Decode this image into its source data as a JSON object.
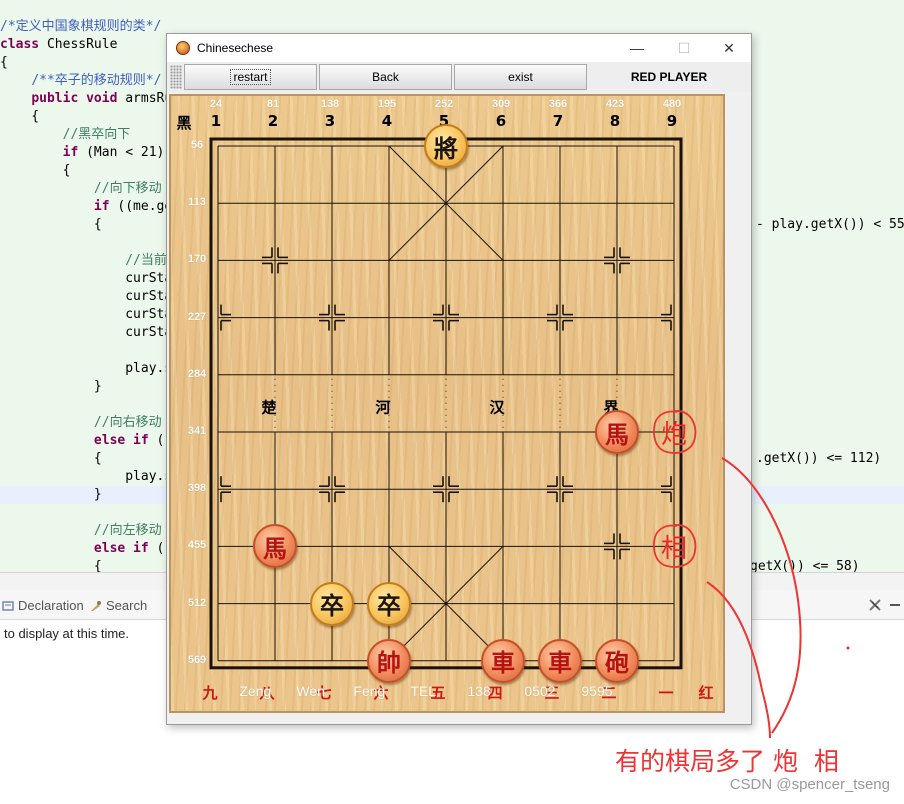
{
  "ide": {
    "code_lines": [
      {
        "parts": [
          {
            "cls": "jd",
            "t": "/*定义中国象棋规则的类*/"
          }
        ]
      },
      {
        "parts": [
          {
            "cls": "kw",
            "t": "class "
          },
          {
            "cls": "rm",
            "t": "ChessRule"
          }
        ]
      },
      {
        "parts": [
          {
            "cls": "rm",
            "t": "{"
          }
        ]
      },
      {
        "parts": [
          {
            "cls": "rm",
            "t": "    "
          },
          {
            "cls": "jd",
            "t": "/**卒子的移动规则*/"
          }
        ]
      },
      {
        "parts": [
          {
            "cls": "rm",
            "t": "    "
          },
          {
            "cls": "kw",
            "t": "public void "
          },
          {
            "cls": "rm",
            "t": "armsRu"
          }
        ]
      },
      {
        "parts": [
          {
            "cls": "rm",
            "t": "    {"
          }
        ]
      },
      {
        "parts": [
          {
            "cls": "rm",
            "t": "        "
          },
          {
            "cls": "cm",
            "t": "//黑卒向下"
          }
        ]
      },
      {
        "parts": [
          {
            "cls": "rm",
            "t": "        "
          },
          {
            "cls": "kw",
            "t": "if "
          },
          {
            "cls": "rm",
            "t": "(Man < 21)"
          }
        ]
      },
      {
        "parts": [
          {
            "cls": "rm",
            "t": "        {"
          }
        ]
      },
      {
        "parts": [
          {
            "cls": "rm",
            "t": "            "
          },
          {
            "cls": "cm",
            "t": "//向下移动"
          }
        ]
      },
      {
        "parts": [
          {
            "cls": "rm",
            "t": "            "
          },
          {
            "cls": "kw",
            "t": "if "
          },
          {
            "cls": "rm",
            "t": "((me.ge"
          }
        ]
      },
      {
        "parts": [
          {
            "cls": "rm",
            "t": "            {"
          }
        ]
      },
      {
        "parts": [
          {
            "cls": "rm",
            "t": ""
          }
        ]
      },
      {
        "parts": [
          {
            "cls": "rm",
            "t": "                "
          },
          {
            "cls": "cm",
            "t": "//当前"
          }
        ]
      },
      {
        "parts": [
          {
            "cls": "rm",
            "t": "                curSta"
          }
        ]
      },
      {
        "parts": [
          {
            "cls": "rm",
            "t": "                curSta"
          }
        ]
      },
      {
        "parts": [
          {
            "cls": "rm",
            "t": "                curSta"
          }
        ]
      },
      {
        "parts": [
          {
            "cls": "rm",
            "t": "                curSta"
          }
        ]
      },
      {
        "parts": [
          {
            "cls": "rm",
            "t": ""
          }
        ]
      },
      {
        "parts": [
          {
            "cls": "rm",
            "t": "                play.s"
          }
        ]
      },
      {
        "parts": [
          {
            "cls": "rm",
            "t": "            }"
          }
        ]
      },
      {
        "parts": [
          {
            "cls": "rm",
            "t": ""
          }
        ]
      },
      {
        "parts": [
          {
            "cls": "rm",
            "t": "            "
          },
          {
            "cls": "cm",
            "t": "//向右移动"
          }
        ]
      },
      {
        "parts": [
          {
            "cls": "rm",
            "t": "            "
          },
          {
            "cls": "kw",
            "t": "else if "
          },
          {
            "cls": "rm",
            "t": "("
          }
        ]
      },
      {
        "parts": [
          {
            "cls": "rm",
            "t": "            {"
          }
        ]
      },
      {
        "parts": [
          {
            "cls": "rm",
            "t": "                play.s"
          }
        ]
      },
      {
        "parts": [
          {
            "cls": "rm",
            "t": "            }"
          }
        ]
      },
      {
        "parts": [
          {
            "cls": "rm",
            "t": ""
          }
        ]
      },
      {
        "parts": [
          {
            "cls": "rm",
            "t": "            "
          },
          {
            "cls": "cm",
            "t": "//向左移动"
          }
        ]
      },
      {
        "parts": [
          {
            "cls": "rm",
            "t": "            "
          },
          {
            "cls": "kw",
            "t": "else if "
          },
          {
            "cls": "rm",
            "t": "("
          }
        ]
      },
      {
        "parts": [
          {
            "cls": "rm",
            "t": "            {"
          }
        ]
      }
    ],
    "code_right": [
      {
        "line": 11,
        "text": "- play.getX()) < 55"
      },
      {
        "line": 24,
        "text": ".getX()) <= 112)"
      },
      {
        "line": 30,
        "text": "getX()) <= 58)"
      }
    ],
    "panel_tabs": [
      {
        "icon": "declaration-icon",
        "label": "Declaration"
      },
      {
        "icon": "search-icon",
        "label": "Search"
      }
    ],
    "panel_message": "to display at this time."
  },
  "window": {
    "title": "Chinesechese",
    "controls": {
      "minimize": "—",
      "maximize": "☐",
      "close": "✕"
    },
    "toolbar": {
      "restart": "restart",
      "back": "Back",
      "exist": "exist",
      "player": "RED PLAYER"
    }
  },
  "board": {
    "top_coords": [
      "24",
      "81",
      "138",
      "195",
      "252",
      "309",
      "366",
      "423",
      "480"
    ],
    "col_numbers_top": [
      "1",
      "2",
      "3",
      "4",
      "5",
      "6",
      "7",
      "8",
      "9"
    ],
    "black_side_label": "黑",
    "left_coords": [
      "56",
      "113",
      "170",
      "227",
      "284",
      "341",
      "398",
      "455",
      "512",
      "569"
    ],
    "river": [
      "楚",
      "河",
      "汉",
      "界"
    ],
    "bottom_nums": [
      "九",
      "八",
      "七",
      "六",
      "五",
      "四",
      "三",
      "二",
      "一"
    ],
    "red_side_label": "红",
    "bottom_words": [
      {
        "t": "Zeng",
        "c": 1.2
      },
      {
        "t": "Wen",
        "c": 2.2
      },
      {
        "t": "Feng",
        "c": 3.2
      },
      {
        "t": "TEL",
        "c": 4.2
      },
      {
        "t": "138",
        "c": 5.2
      },
      {
        "t": "0502",
        "c": 6.2
      },
      {
        "t": "9595",
        "c": 7.2
      }
    ],
    "pieces": [
      {
        "char": "將",
        "side": "black",
        "col": 4,
        "row": 0
      },
      {
        "char": "馬",
        "side": "red",
        "col": 7,
        "row": 5
      },
      {
        "char": "炮",
        "side": "red-outline",
        "col": 8,
        "row": 5
      },
      {
        "char": "相",
        "side": "red-outline",
        "col": 8,
        "row": 7
      },
      {
        "char": "馬",
        "side": "red",
        "col": 1,
        "row": 7
      },
      {
        "char": "卒",
        "side": "black",
        "col": 2,
        "row": 8
      },
      {
        "char": "卒",
        "side": "black",
        "col": 3,
        "row": 8
      },
      {
        "char": "帥",
        "side": "red",
        "col": 3,
        "row": 9
      },
      {
        "char": "車",
        "side": "red",
        "col": 5,
        "row": 9
      },
      {
        "char": "車",
        "side": "red",
        "col": 6,
        "row": 9
      },
      {
        "char": "砲",
        "side": "red",
        "col": 7,
        "row": 9
      }
    ]
  },
  "annotation": {
    "caption": "有的棋局多了 炮  相",
    "color": "#ee3333"
  },
  "watermark": "CSDN @spencer_tseng"
}
